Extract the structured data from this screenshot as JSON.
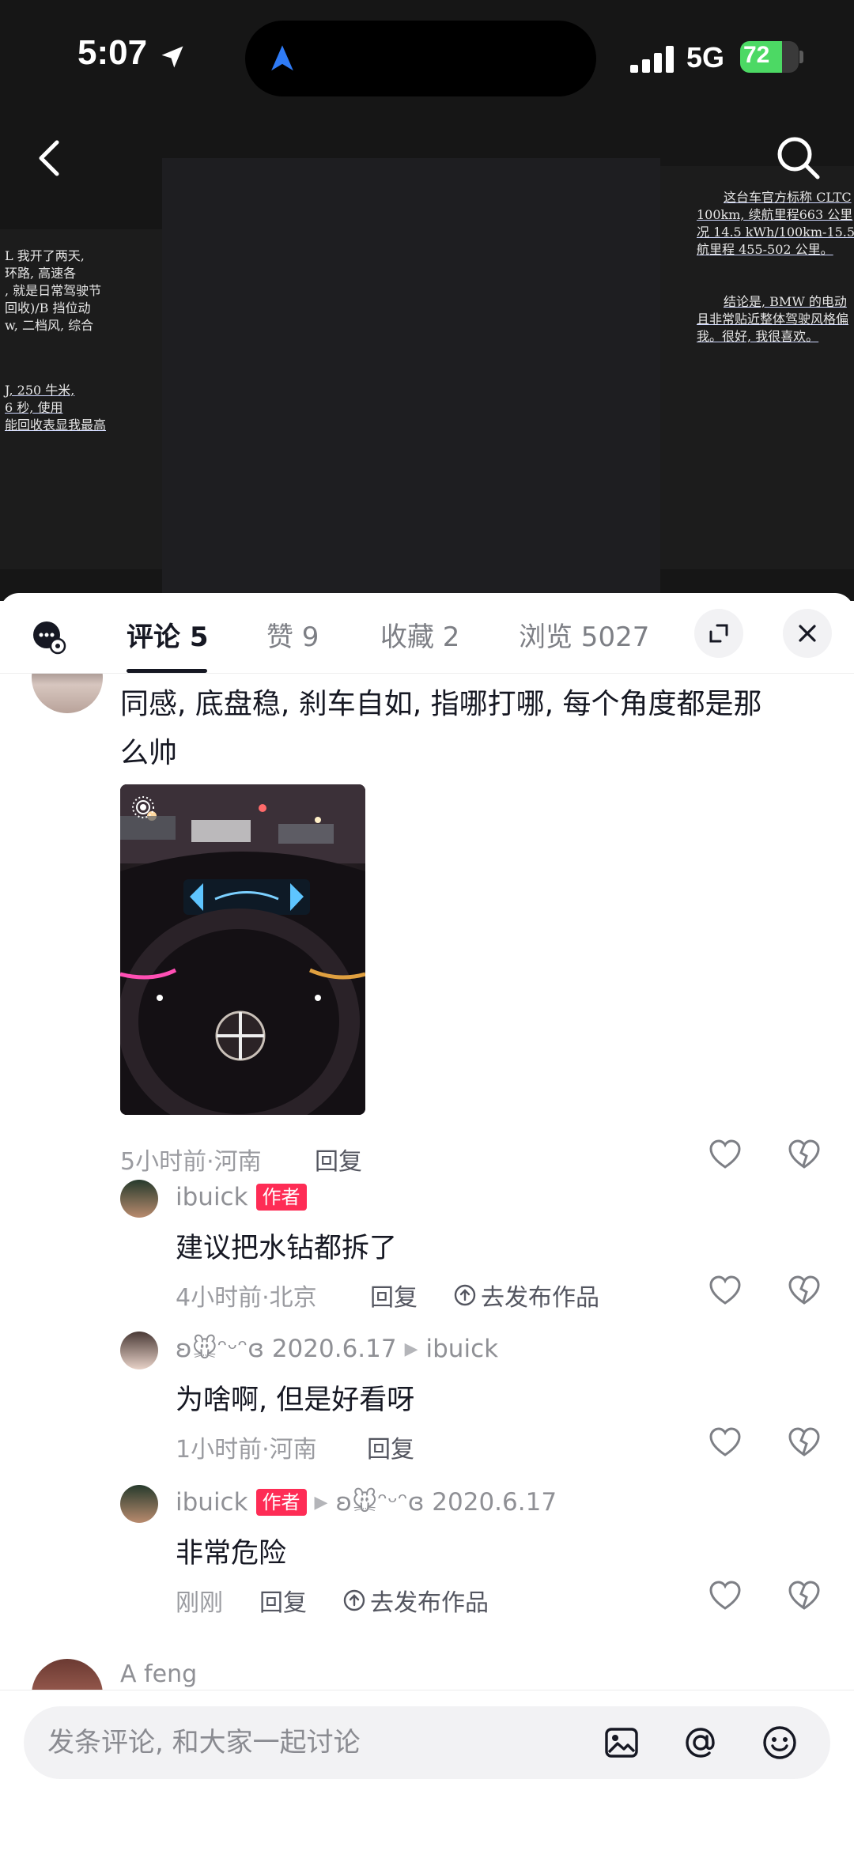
{
  "status_bar": {
    "time": "5:07",
    "network": "5G",
    "battery": "72",
    "battery_level": 0.72
  },
  "document_preview": {
    "left_lines": [
      "L 我开了两天,",
      "环路, 高速各",
      ", 就是日常驾驶节",
      "回收)/B 挡位动",
      "w, 二档风, 综合",
      "",
      "J, 250 牛米,",
      "6 秒, 使用",
      "能回收表显我最高"
    ],
    "right_lines": [
      "这台车官方标称 CLTC",
      "100km, 续航里程663 公里",
      "况 14.5 kWh/100km-15.5",
      "航里程 455-502 公里。",
      "",
      "结论是, BMW 的电动",
      "且非常贴近整体驾驶风格偏",
      "我。很好, 我很喜欢。"
    ]
  },
  "tabs": [
    {
      "label": "评论 5"
    },
    {
      "label": "赞 9"
    },
    {
      "label": "收藏 2"
    },
    {
      "label": "浏览 5027"
    }
  ],
  "comment": {
    "text_line1": "同感, 底盘稳, 刹车自如, 指哪打哪, 每个角度都是那",
    "text_line2": "么帅",
    "meta": "5小时前·河南",
    "reply": "回复"
  },
  "replies": [
    {
      "name": "ibuick",
      "badge": "作者",
      "text": "建议把水钻都拆了",
      "meta": "4小时前·北京",
      "reply": "回复",
      "publish": "去发布作品"
    },
    {
      "name": "ʚ🐭ᵔᵕᵔɞ 2020.6.17",
      "reply_to": "ibuick",
      "text": "为啥啊, 但是好看呀",
      "meta": "1小时前·河南",
      "reply": "回复"
    },
    {
      "name": "ibuick",
      "badge": "作者",
      "reply_to": "ʚ🐭ᵔᵕᵔɞ 2020.6.17",
      "text": "非常危险",
      "meta": "刚刚",
      "reply": "回复",
      "publish": "去发布作品"
    }
  ],
  "next_comment": {
    "name": "A feng"
  },
  "input": {
    "placeholder": "发条评论, 和大家一起讨论"
  },
  "colors": {
    "accent_red": "#fe2c55",
    "battery_green": "#4cd964"
  }
}
